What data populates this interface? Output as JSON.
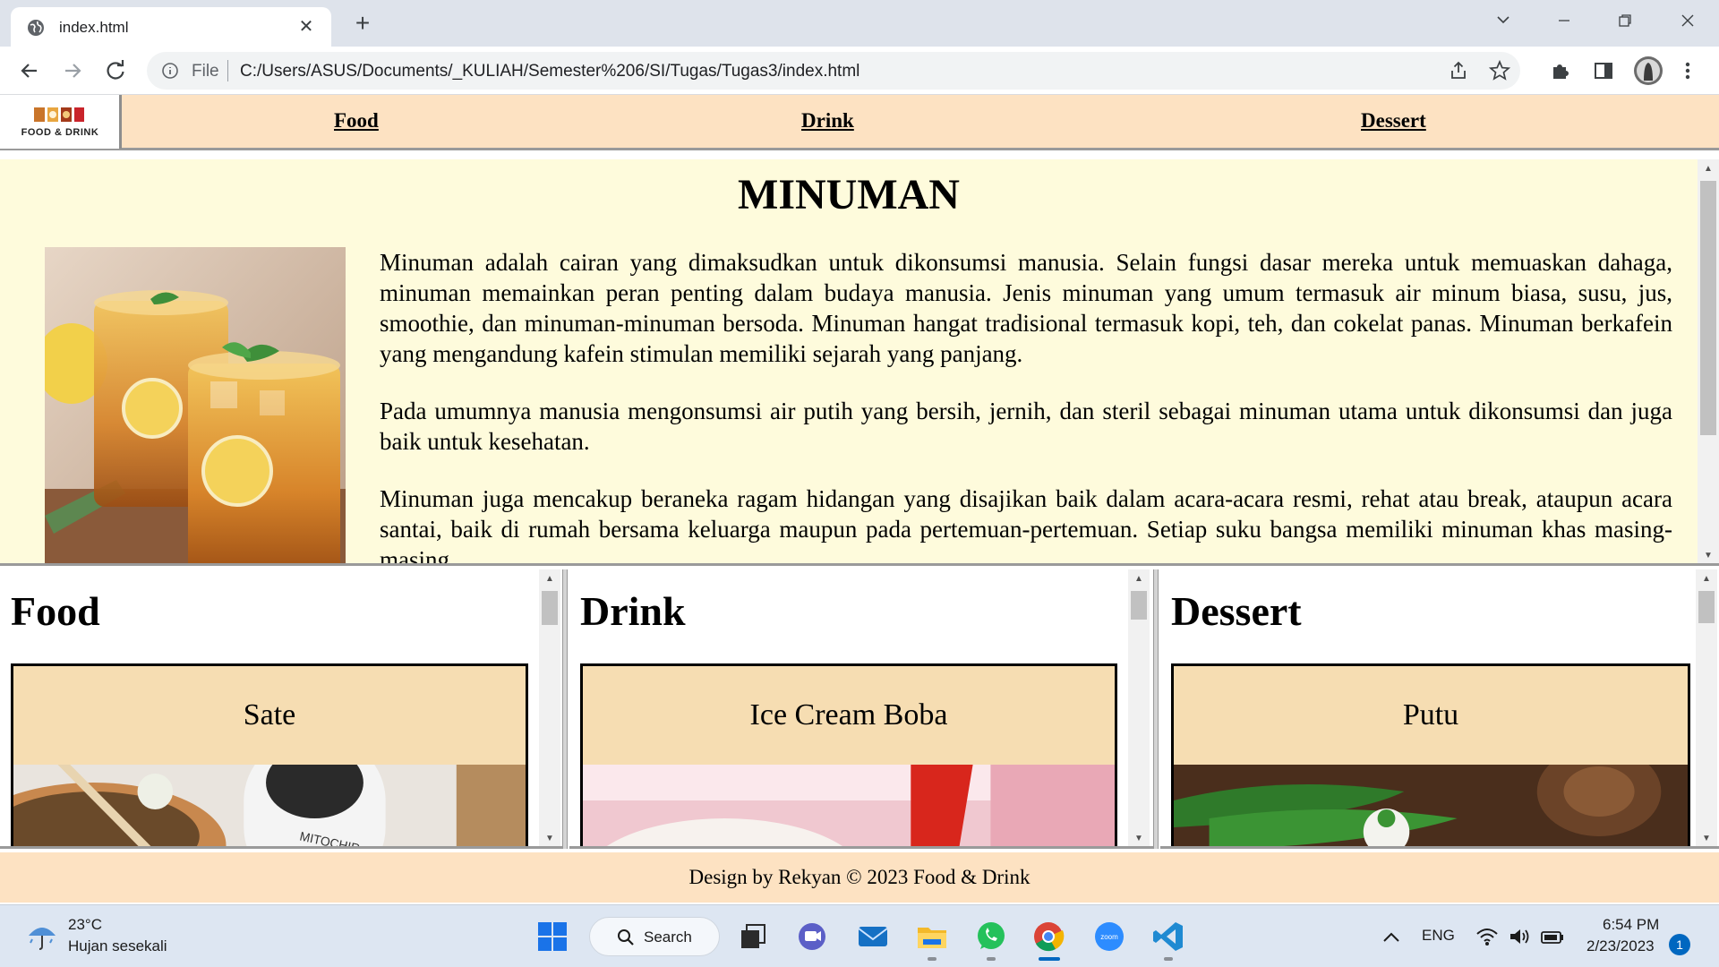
{
  "browser": {
    "tab_title": "index.html",
    "address_scheme_label": "File",
    "address_url": "C:/Users/ASUS/Documents/_KULIAH/Semester%206/SI/Tugas/Tugas3/index.html"
  },
  "site_nav": {
    "logo_text": "FOOD & DRINK",
    "links": [
      "Food",
      "Drink",
      "Dessert"
    ]
  },
  "main": {
    "title": "MINUMAN",
    "paragraphs": [
      "Minuman adalah cairan yang dimaksudkan untuk dikonsumsi manusia. Selain fungsi dasar mereka untuk memuaskan dahaga, minuman memainkan peran penting dalam budaya manusia. Jenis minuman yang umum termasuk air minum biasa, susu, jus, smoothie, dan minuman-minuman bersoda. Minuman hangat tradisional termasuk kopi, teh, dan cokelat panas. Minuman berkafein yang mengandung kafein stimulan memiliki sejarah yang panjang.",
      "Pada umumnya manusia mengonsumsi air putih yang bersih, jernih, dan steril sebagai minuman utama untuk dikonsumsi dan juga baik untuk kesehatan.",
      "Minuman juga mencakup beraneka ragam hidangan yang disajikan baik dalam acara-acara resmi, rehat atau break, ataupun acara santai, baik di rumah bersama keluarga maupun pada pertemuan-pertemuan. Setiap suku bangsa memiliki minuman khas masing-masing."
    ]
  },
  "frames": [
    {
      "heading": "Food",
      "card_title": "Sate"
    },
    {
      "heading": "Drink",
      "card_title": "Ice Cream Boba"
    },
    {
      "heading": "Dessert",
      "card_title": "Putu"
    }
  ],
  "footer": {
    "text": "Design by Rekyan © 2023 Food & Drink"
  },
  "taskbar": {
    "weather_temp": "23°C",
    "weather_desc": "Hujan sesekali",
    "search_label": "Search",
    "language": "ENG",
    "time": "6:54 PM",
    "date": "2/23/2023",
    "notification_count": "1"
  },
  "colors": {
    "nav_bg": "#fde2c2",
    "main_bg": "#fefbdc",
    "card_bg": "#f6ddb2"
  }
}
